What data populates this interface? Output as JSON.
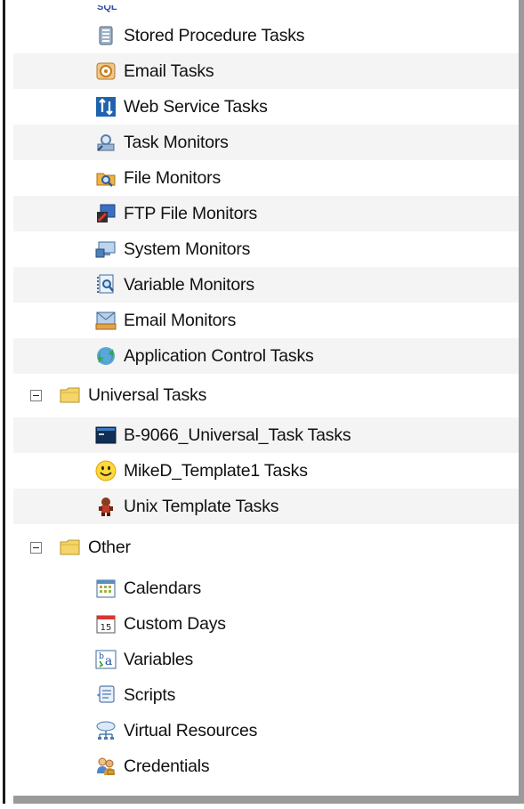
{
  "tree": {
    "cut_top_label": "SQL",
    "group1_items": [
      {
        "label": "Stored Procedure Tasks",
        "icon": "stored-procedure-icon"
      },
      {
        "label": "Email Tasks",
        "icon": "email-task-icon"
      },
      {
        "label": "Web Service Tasks",
        "icon": "web-service-icon"
      },
      {
        "label": "Task Monitors",
        "icon": "task-monitor-icon"
      },
      {
        "label": "File Monitors",
        "icon": "file-monitor-icon"
      },
      {
        "label": "FTP File Monitors",
        "icon": "ftp-file-monitor-icon"
      },
      {
        "label": "System Monitors",
        "icon": "system-monitor-icon"
      },
      {
        "label": "Variable Monitors",
        "icon": "variable-monitor-icon"
      },
      {
        "label": "Email Monitors",
        "icon": "email-monitor-icon"
      },
      {
        "label": "Application Control Tasks",
        "icon": "application-control-icon"
      }
    ],
    "universal": {
      "label": "Universal Tasks",
      "items": [
        {
          "label": "B-9066_Universal_Task Tasks",
          "icon": "terminal-icon"
        },
        {
          "label": "MikeD_Template1 Tasks",
          "icon": "smiley-icon"
        },
        {
          "label": "Unix Template Tasks",
          "icon": "character-icon"
        }
      ]
    },
    "other": {
      "label": "Other",
      "items": [
        {
          "label": "Calendars",
          "icon": "calendar-icon"
        },
        {
          "label": "Custom Days",
          "icon": "custom-days-icon"
        },
        {
          "label": "Variables",
          "icon": "variables-icon"
        },
        {
          "label": "Scripts",
          "icon": "scripts-icon"
        },
        {
          "label": "Virtual Resources",
          "icon": "virtual-resources-icon"
        },
        {
          "label": "Credentials",
          "icon": "credentials-icon"
        }
      ]
    }
  }
}
